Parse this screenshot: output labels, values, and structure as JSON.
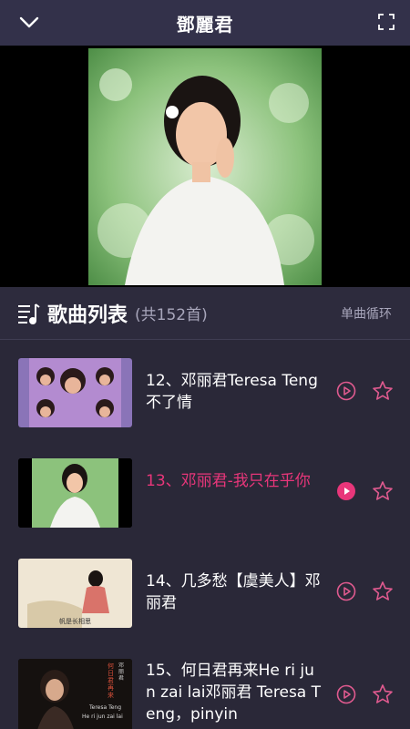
{
  "header": {
    "title": "鄧麗君",
    "back_icon": "chevron-down-icon",
    "fullscreen_icon": "fullscreen-icon"
  },
  "playlist": {
    "title": "歌曲列表",
    "count": "(共152首)",
    "mode": "单曲循环",
    "icon": "music-list-icon"
  },
  "songs": [
    {
      "name": "12、邓丽君Teresa Teng不了情",
      "active": false
    },
    {
      "name": "13、邓丽君-我只在乎你",
      "active": true
    },
    {
      "name": "14、几多愁【虞美人】邓丽君",
      "active": false
    },
    {
      "name": "15、何日君再来He ri jun zai lai邓丽君 Teresa Teng，pinyin",
      "active": false
    }
  ],
  "thumb_captions": {
    "t3": "帆是长相思",
    "t4_title": "何日君再来",
    "t4_name": "Teresa Teng",
    "t4_pinyin": "He ri jun zai lai",
    "t4_cn": "邓丽君"
  },
  "colors": {
    "accent": "#e8367a",
    "icon": "#e05a8f",
    "bg": "#2a2838"
  }
}
